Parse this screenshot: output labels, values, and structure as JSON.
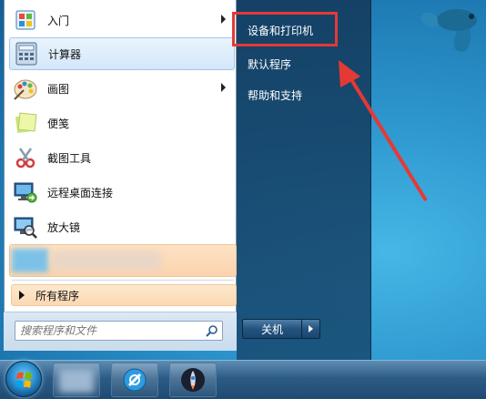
{
  "start_menu": {
    "programs": [
      {
        "label": "入门",
        "icon": "getting-started-icon",
        "has_submenu": true
      },
      {
        "label": "计算器",
        "icon": "calculator-icon",
        "has_submenu": false,
        "highlighted": true
      },
      {
        "label": "画图",
        "icon": "paint-icon",
        "has_submenu": true
      },
      {
        "label": "便笺",
        "icon": "sticky-notes-icon",
        "has_submenu": false
      },
      {
        "label": "截图工具",
        "icon": "snipping-tool-icon",
        "has_submenu": false
      },
      {
        "label": "远程桌面连接",
        "icon": "remote-desktop-icon",
        "has_submenu": false
      },
      {
        "label": "放大镜",
        "icon": "magnifier-icon",
        "has_submenu": false
      }
    ],
    "all_programs_label": "所有程序",
    "search_placeholder": "搜索程序和文件"
  },
  "right_panel": {
    "items": [
      {
        "label": "设备和打印机",
        "boxed": true
      },
      {
        "label": "默认程序"
      },
      {
        "label": "帮助和支持"
      }
    ],
    "shutdown_label": "关机"
  },
  "annotation": {
    "box_color": "#e53935",
    "arrow_color": "#e53935"
  }
}
